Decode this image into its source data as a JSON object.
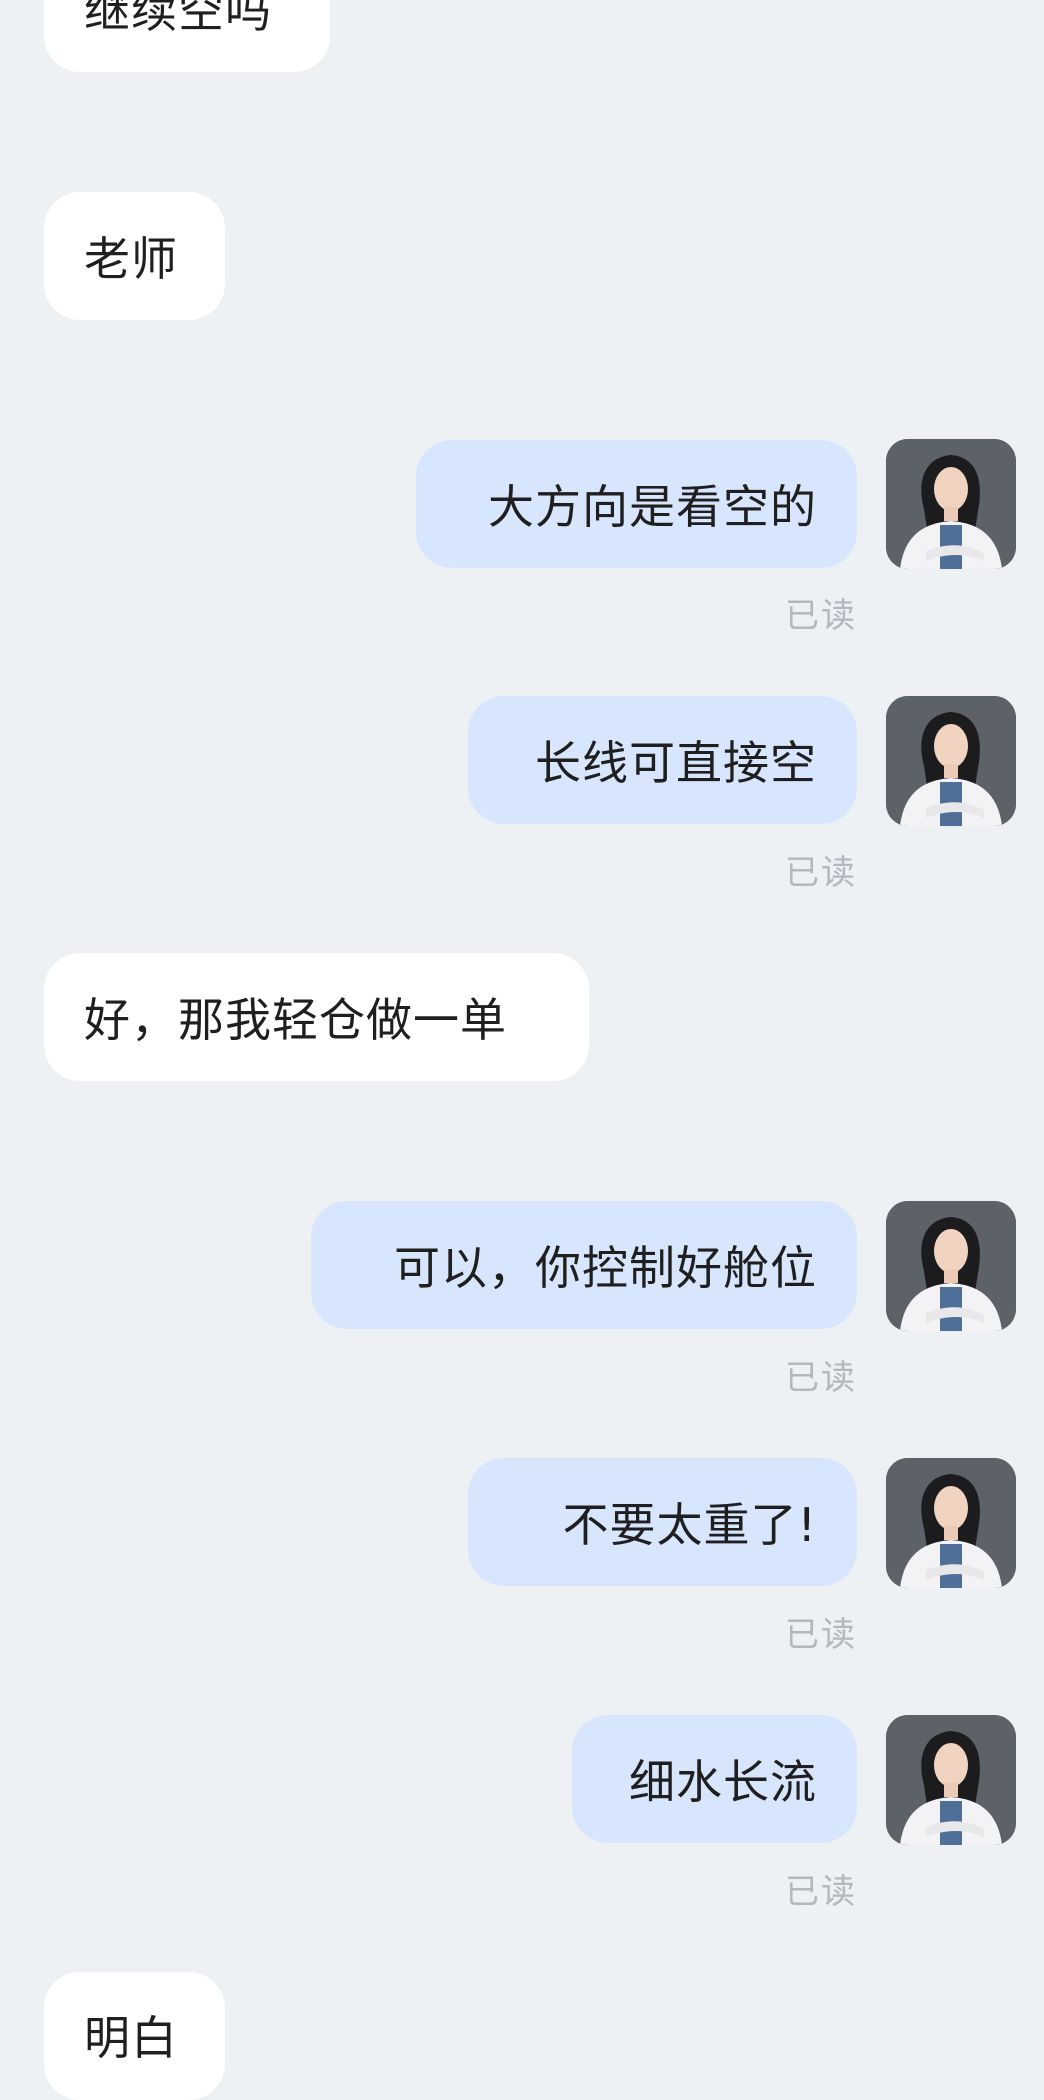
{
  "messages": [
    {
      "side": "in",
      "text": "继续空吗"
    },
    {
      "side": "in",
      "text": "老师"
    },
    {
      "side": "out",
      "text": "大方向是看空的",
      "status": "已读"
    },
    {
      "side": "out",
      "text": "长线可直接空",
      "status": "已读"
    },
    {
      "side": "in",
      "text": "好，那我轻仓做一单"
    },
    {
      "side": "out",
      "text": "可以，你控制好舱位",
      "status": "已读"
    },
    {
      "side": "out",
      "text": "不要太重了!",
      "status": "已读"
    },
    {
      "side": "out",
      "text": "细水长流",
      "status": "已读"
    },
    {
      "side": "in",
      "text": "明白"
    }
  ],
  "avatar": {
    "icon": "teacher-avatar-photo"
  }
}
